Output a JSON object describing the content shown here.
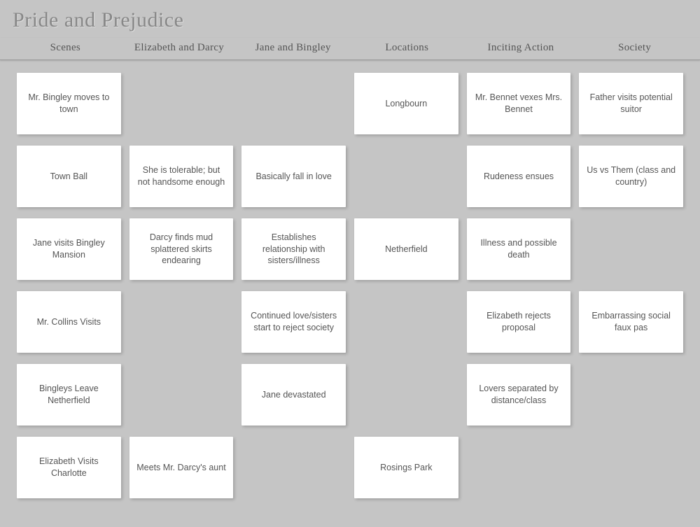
{
  "title": "Pride and Prejudice",
  "columns": [
    "Scenes",
    "Elizabeth and Darcy",
    "Jane and Bingley",
    "Locations",
    "Inciting Action",
    "Society"
  ],
  "grid": [
    [
      "Mr. Bingley moves to town",
      "",
      "",
      "Longbourn",
      "Mr. Bennet vexes Mrs. Bennet",
      "Father visits potential suitor"
    ],
    [
      "Town Ball",
      "She is tolerable; but not handsome enough",
      "Basically fall in love",
      "",
      "Rudeness ensues",
      "Us vs Them (class and country)"
    ],
    [
      "Jane visits Bingley Mansion",
      "Darcy finds mud splattered skirts endearing",
      "Establishes relationship with sisters/illness",
      "Netherfield",
      "Illness and possible death",
      ""
    ],
    [
      "Mr. Collins Visits",
      "",
      "Continued love/sisters start to reject society",
      "",
      "Elizabeth rejects proposal",
      "Embarrassing social faux pas"
    ],
    [
      "Bingleys Leave Netherfield",
      "",
      "Jane devastated",
      "",
      "Lovers separated by distance/class",
      ""
    ],
    [
      "Elizabeth Visits Charlotte",
      "Meets Mr. Darcy's aunt",
      "",
      "Rosings Park",
      "",
      ""
    ]
  ]
}
